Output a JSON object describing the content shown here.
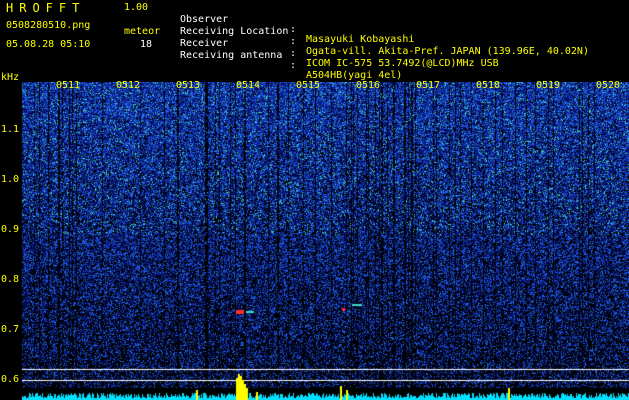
{
  "header": {
    "app_title": "HROFFT",
    "version": "1.00",
    "filename": "0508280510.png",
    "meteor_label": "meteor",
    "meteor_count": "18",
    "datetime": "05.08.28 05:10"
  },
  "info": {
    "observer": {
      "label": "Observer",
      "value": "Masayuki Kobayashi"
    },
    "location": {
      "label": "Receiving Location",
      "value": "Ogata-vill. Akita-Pref. JAPAN (139.96E, 40.02N)"
    },
    "receiver": {
      "label": "Receiver",
      "value": "ICOM IC-575 53.7492(@LCD)MHz USB"
    },
    "antenna": {
      "label": "Receiving antenna",
      "value": "A504HB(yagi 4el)"
    }
  },
  "spectrogram": {
    "unit": "kHz",
    "y_ticks": [
      "1.1",
      "1.0",
      "0.9",
      "0.8",
      "0.7",
      "0.6"
    ],
    "time_labels": [
      "0511",
      "0512",
      "0513",
      "0514",
      "0515",
      "0516",
      "0517",
      "0518",
      "0519",
      "0520"
    ],
    "colors": {
      "background": "#000000",
      "noise_low": "#0a1a8a",
      "noise_mid": "#1f5fe0",
      "noise_high": "#3fd8c8",
      "grid": "#ffffff",
      "activity": "#00e0ff",
      "peak": "#ffff00",
      "echo": "#ff3030"
    }
  }
}
